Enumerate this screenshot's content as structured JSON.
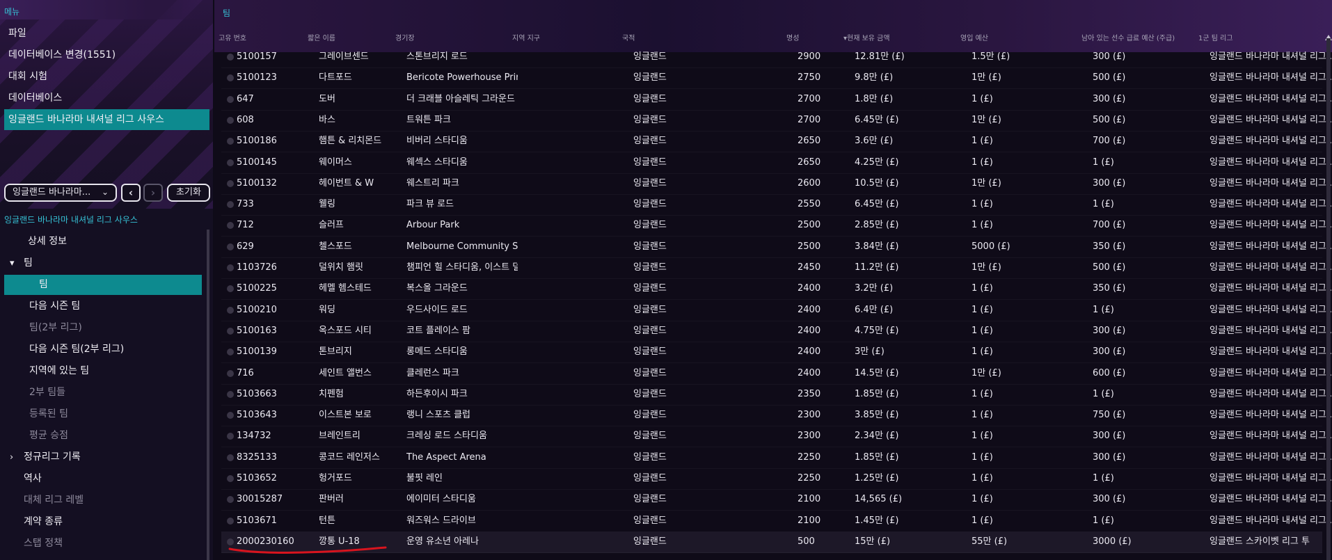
{
  "sidebar": {
    "header": "메뉴",
    "menu_items": [
      "파일",
      "데이터베이스 변경(1551)",
      "대회 시험",
      "데이터베이스",
      "잉글랜드 바나라마 내셔널 리그 사우스"
    ],
    "filter": {
      "selected": "잉글랜드 바나라마...",
      "reset_label": "초기화"
    },
    "section_title": "잉글랜드 바나라마 내셔널 리그 사우스",
    "tree": [
      {
        "label": "상세 정보",
        "state": "normal",
        "caret": ""
      },
      {
        "label": "팀",
        "state": "normal",
        "caret": "▾"
      },
      {
        "label": "팀",
        "state": "active",
        "caret": ""
      },
      {
        "label": "다음 시즌 팀",
        "state": "normal",
        "caret": ""
      },
      {
        "label": "팀(2부 리그)",
        "state": "dim",
        "caret": ""
      },
      {
        "label": "다음 시즌 팀(2부 리그)",
        "state": "normal",
        "caret": ""
      },
      {
        "label": "지역에 있는 팀",
        "state": "normal",
        "caret": ""
      },
      {
        "label": "2부 팀들",
        "state": "dim",
        "caret": ""
      },
      {
        "label": "등록된 팀",
        "state": "dim",
        "caret": ""
      },
      {
        "label": "평균 승점",
        "state": "dim",
        "caret": ""
      },
      {
        "label": "정규리그 기록",
        "state": "normal",
        "caret": "›"
      },
      {
        "label": "역사",
        "state": "normal",
        "caret": ""
      },
      {
        "label": "대체 리그 레벨",
        "state": "dim",
        "caret": ""
      },
      {
        "label": "계약 종류",
        "state": "normal",
        "caret": ""
      },
      {
        "label": "스탭 정책",
        "state": "dim",
        "caret": ""
      }
    ]
  },
  "table": {
    "title": "팀",
    "headers": [
      "고유 번호",
      "짧은 이름",
      "경기장",
      "지역 지구",
      "국적",
      "명성",
      "▾현재 보유 금액",
      "영입 예산",
      "남아 있는 선수 급료 예산 (주급)",
      "1군 팀 리그"
    ],
    "rows": [
      [
        "5100157",
        "그레이브센드",
        "스톤브리지 로드",
        "",
        "잉글랜드",
        "2900",
        "12.81만 (£)",
        "1.5만 (£)",
        "300 (£)",
        "잉글랜드 바나라마 내셔널 리그..."
      ],
      [
        "5100123",
        "다트포드",
        "Bericote Powerhouse Princes...",
        "",
        "잉글랜드",
        "2750",
        "9.8만 (£)",
        "1만 (£)",
        "500 (£)",
        "잉글랜드 바나라마 내셔널 리그..."
      ],
      [
        "647",
        "도버",
        "더 크래블 아슬레틱 그라운드",
        "",
        "잉글랜드",
        "2700",
        "1.8만 (£)",
        "1 (£)",
        "300 (£)",
        "잉글랜드 바나라마 내셔널 리그..."
      ],
      [
        "608",
        "바스",
        "트워튼 파크",
        "",
        "잉글랜드",
        "2700",
        "6.45만 (£)",
        "1만 (£)",
        "500 (£)",
        "잉글랜드 바나라마 내셔널 리그..."
      ],
      [
        "5100186",
        "햄튼 & 리치몬드",
        "비버리 스타디움",
        "",
        "잉글랜드",
        "2650",
        "3.6만 (£)",
        "1 (£)",
        "700 (£)",
        "잉글랜드 바나라마 내셔널 리그..."
      ],
      [
        "5100145",
        "웨이머스",
        "웨섹스 스타디움",
        "",
        "잉글랜드",
        "2650",
        "4.25만 (£)",
        "1 (£)",
        "1 (£)",
        "잉글랜드 바나라마 내셔널 리그..."
      ],
      [
        "5100132",
        "헤이번트 & W",
        "웨스트리 파크",
        "",
        "잉글랜드",
        "2600",
        "10.5만 (£)",
        "1만 (£)",
        "300 (£)",
        "잉글랜드 바나라마 내셔널 리그..."
      ],
      [
        "733",
        "웰링",
        "파크 뷰 로드",
        "",
        "잉글랜드",
        "2550",
        "6.45만 (£)",
        "1 (£)",
        "1 (£)",
        "잉글랜드 바나라마 내셔널 리그..."
      ],
      [
        "712",
        "슬러프",
        "Arbour Park",
        "",
        "잉글랜드",
        "2500",
        "2.85만 (£)",
        "1 (£)",
        "700 (£)",
        "잉글랜드 바나라마 내셔널 리그..."
      ],
      [
        "629",
        "첼스포드",
        "Melbourne Community Stadiu...",
        "",
        "잉글랜드",
        "2500",
        "3.84만 (£)",
        "5000 (£)",
        "350 (£)",
        "잉글랜드 바나라마 내셔널 리그..."
      ],
      [
        "1103726",
        "덜위치 햄릿",
        "챔피언 힐 스타디움, 이스트 덜위...",
        "",
        "잉글랜드",
        "2450",
        "11.2만 (£)",
        "1만 (£)",
        "500 (£)",
        "잉글랜드 바나라마 내셔널 리그..."
      ],
      [
        "5100225",
        "헤멜 헴스테드",
        "복스올 그라운드",
        "",
        "잉글랜드",
        "2400",
        "3.2만 (£)",
        "1 (£)",
        "350 (£)",
        "잉글랜드 바나라마 내셔널 리그..."
      ],
      [
        "5100210",
        "워딩",
        "우드사이드 로드",
        "",
        "잉글랜드",
        "2400",
        "6.4만 (£)",
        "1 (£)",
        "1 (£)",
        "잉글랜드 바나라마 내셔널 리그..."
      ],
      [
        "5100163",
        "옥스포드 시티",
        "코트 플레이스 팜",
        "",
        "잉글랜드",
        "2400",
        "4.75만 (£)",
        "1 (£)",
        "300 (£)",
        "잉글랜드 바나라마 내셔널 리그..."
      ],
      [
        "5100139",
        "톤브리지",
        "롱메드 스타디움",
        "",
        "잉글랜드",
        "2400",
        "3만 (£)",
        "1 (£)",
        "300 (£)",
        "잉글랜드 바나라마 내셔널 리그..."
      ],
      [
        "716",
        "세인트 앨번스",
        "클레런스 파크",
        "",
        "잉글랜드",
        "2400",
        "14.5만 (£)",
        "1만 (£)",
        "600 (£)",
        "잉글랜드 바나라마 내셔널 리그..."
      ],
      [
        "5103663",
        "치펜험",
        "하든후이시 파크",
        "",
        "잉글랜드",
        "2350",
        "1.85만 (£)",
        "1 (£)",
        "1 (£)",
        "잉글랜드 바나라마 내셔널 리그..."
      ],
      [
        "5103643",
        "이스트본 보로",
        "랭니 스포츠 클럽",
        "",
        "잉글랜드",
        "2300",
        "3.85만 (£)",
        "1 (£)",
        "750 (£)",
        "잉글랜드 바나라마 내셔널 리그..."
      ],
      [
        "134732",
        "브레인트리",
        "크레싱 로드 스타디움",
        "",
        "잉글랜드",
        "2300",
        "2.34만 (£)",
        "1 (£)",
        "300 (£)",
        "잉글랜드 바나라마 내셔널 리그..."
      ],
      [
        "8325133",
        "콩코드 레인저스",
        "The Aspect Arena",
        "",
        "잉글랜드",
        "2250",
        "1.85만 (£)",
        "1 (£)",
        "300 (£)",
        "잉글랜드 바나라마 내셔널 리그..."
      ],
      [
        "5103652",
        "헝거포드",
        "불핏 레인",
        "",
        "잉글랜드",
        "2250",
        "1.25만 (£)",
        "1 (£)",
        "1 (£)",
        "잉글랜드 바나라마 내셔널 리그..."
      ],
      [
        "30015287",
        "판버러",
        "에이미터 스타디움",
        "",
        "잉글랜드",
        "2100",
        "14,565 (£)",
        "1 (£)",
        "300 (£)",
        "잉글랜드 바나라마 내셔널 리그..."
      ],
      [
        "5103671",
        "턴튼",
        "워즈워스 드라이브",
        "",
        "잉글랜드",
        "2100",
        "1.45만 (£)",
        "1 (£)",
        "1 (£)",
        "잉글랜드 바나라마 내셔널 리그..."
      ],
      [
        "2000230160",
        "깡통   U-18",
        "운영  유소년  아레나",
        "",
        "잉글랜드",
        "500",
        "15만 (£)",
        "55만 (£)",
        "3000 (£)",
        "잉글랜드 스카이벳 리그 투"
      ]
    ]
  },
  "colors": {
    "accent_teal": "#0d8a8f",
    "header_cyan": "#36c2d6",
    "annotation_red": "#d8141e"
  }
}
